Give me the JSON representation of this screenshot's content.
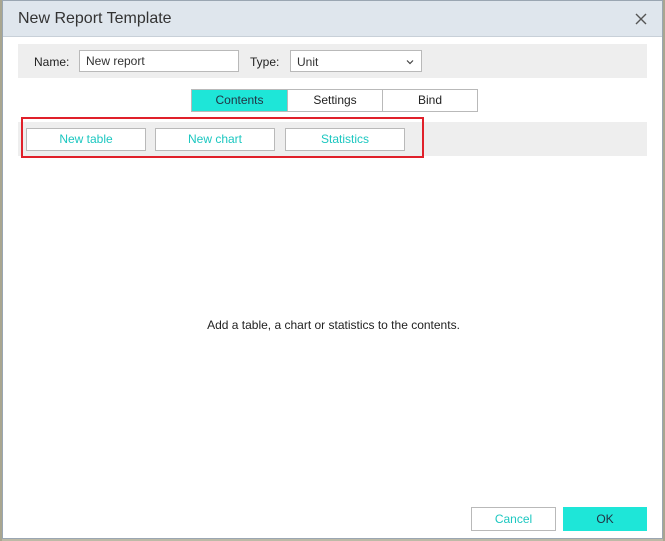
{
  "dialog": {
    "title": "New Report Template",
    "close_icon": "close-icon"
  },
  "form": {
    "name_label": "Name:",
    "name_value": "New report",
    "type_label": "Type:",
    "type_value": "Unit"
  },
  "tabs": [
    {
      "label": "Contents",
      "active": true
    },
    {
      "label": "Settings",
      "active": false
    },
    {
      "label": "Bind",
      "active": false
    }
  ],
  "toolbar": {
    "new_table": "New table",
    "new_chart": "New chart",
    "statistics": "Statistics"
  },
  "content": {
    "empty_message": "Add a table, a chart or statistics to the contents."
  },
  "footer": {
    "cancel": "Cancel",
    "ok": "OK"
  },
  "colors": {
    "accent": "#1ee6d8",
    "accent_text": "#1cc7c0",
    "highlight": "#e0202a",
    "titlebar": "#dfe6ed"
  }
}
